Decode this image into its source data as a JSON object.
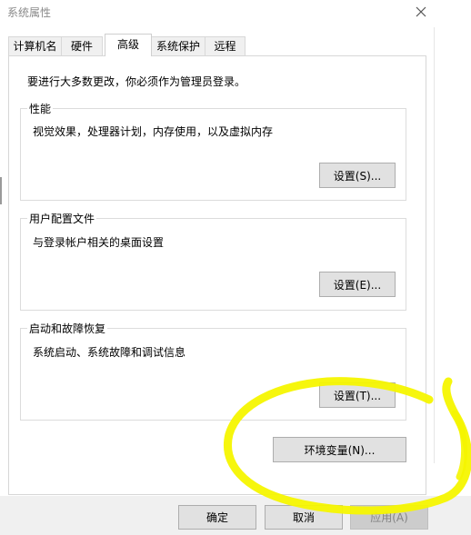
{
  "window": {
    "title": "系统属性"
  },
  "tabs": [
    {
      "label": "计算机名",
      "active": false
    },
    {
      "label": "硬件",
      "active": false
    },
    {
      "label": "高级",
      "active": true
    },
    {
      "label": "系统保护",
      "active": false
    },
    {
      "label": "远程",
      "active": false
    }
  ],
  "advanced": {
    "admin_note": "要进行大多数更改，你必须作为管理员登录。",
    "performance": {
      "title": "性能",
      "description": "视觉效果，处理器计划，内存使用，以及虚拟内存",
      "button": "设置(S)..."
    },
    "user_profiles": {
      "title": "用户配置文件",
      "description": "与登录帐户相关的桌面设置",
      "button": "设置(E)..."
    },
    "startup_recovery": {
      "title": "启动和故障恢复",
      "description": "系统启动、系统故障和调试信息",
      "button": "设置(T)..."
    },
    "env_button": "环境变量(N)..."
  },
  "footer": {
    "ok": "确定",
    "cancel": "取消",
    "apply": "应用(A)"
  },
  "icons": {
    "close": "close-icon"
  },
  "colors": {
    "annotation": "#f5f500",
    "button_bg": "#e1e1e1",
    "disabled_text": "#838383"
  }
}
